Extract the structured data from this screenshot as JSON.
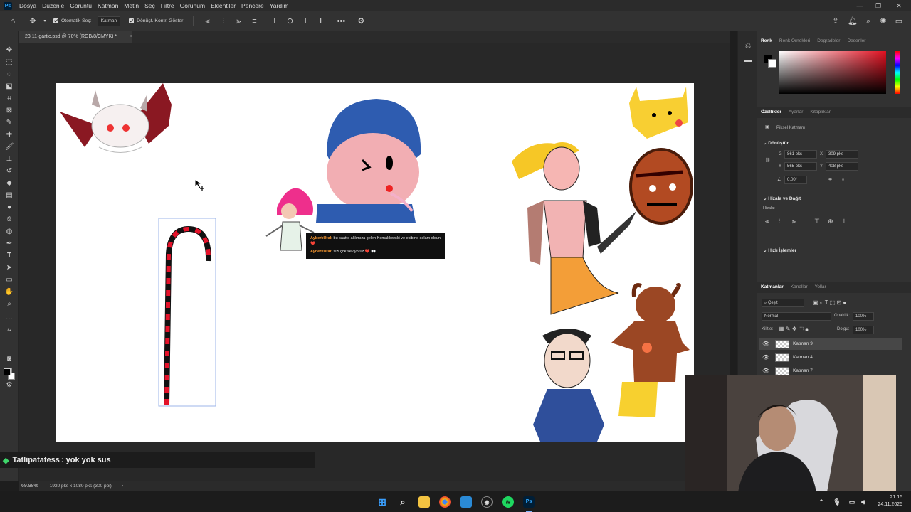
{
  "menu": {
    "app_logo": "Ps",
    "items": [
      "Dosya",
      "Düzenle",
      "Görüntü",
      "Katman",
      "Metin",
      "Seç",
      "Filtre",
      "Görünüm",
      "Eklentiler",
      "Pencere",
      "Yardım"
    ]
  },
  "options_bar": {
    "auto_select_label": "Otomatik Seç:",
    "auto_select_target": "Katman",
    "transform_controls_label": "Dönüşt. Kontr. Göster"
  },
  "document_tab": {
    "title": "23.11-gartic.psd @ 70% (RGB/8/CMYK) *"
  },
  "canvas_chat": {
    "line1_user": "AyberkUral:",
    "line1_text": "bu saatte aklımıza gelen Kemalılowski ve ekibine selam olsun ❤️",
    "line2_user": "AyberkUral:",
    "line2_text": "sizi çok seviyoruz ❤️ 👀"
  },
  "stream_chat": {
    "username": "Tatlipatatess",
    "message": ": yok yok sus"
  },
  "status_bar": {
    "zoom": "69.98%",
    "doc_info": "1920 pks x 1080 pks (300 ppi)"
  },
  "color_panel": {
    "tabs": [
      "Renk",
      "Renk Örnekleri",
      "Degradeler",
      "Desenler"
    ],
    "active_tab": "Renk"
  },
  "properties_panel": {
    "tabs": [
      "Özellikler",
      "Ayarlar",
      "Kitaplıklar"
    ],
    "layer_type": "Piksel Katmanı",
    "transform_title": "Dönüştür",
    "w_label": "G",
    "w_value": "861 pks",
    "x_label": "X",
    "x_value": "309 pks",
    "h_label": "Y",
    "h_value": "565 pks",
    "y_label": "Y",
    "y_value": "408 pks",
    "angle_value": "0.00°",
    "align_title": "Hizala ve Dağıt",
    "align_sub": "Hizala:",
    "quick_actions_title": "Hızlı İşlemler"
  },
  "layers_panel": {
    "tabs": [
      "Katmanlar",
      "Kanallar",
      "Yollar"
    ],
    "filter_label": "Çeşit",
    "blend_mode": "Normal",
    "opacity_label": "Opaklık:",
    "opacity_value": "100%",
    "lock_label": "Kilitle:",
    "fill_label": "Dolgu:",
    "fill_value": "100%",
    "layers": [
      {
        "name": "Katman 9",
        "selected": true
      },
      {
        "name": "Katman 4",
        "selected": false
      },
      {
        "name": "Katman 7",
        "selected": false
      }
    ]
  },
  "taskbar": {
    "time": "21:15",
    "date": "24.11.2025",
    "ps_icon": "Ps"
  },
  "colors": {
    "accent": "#31a8ff",
    "chat_user": "#ff9b2f",
    "stream_user_diamond": "#3fd66b"
  }
}
